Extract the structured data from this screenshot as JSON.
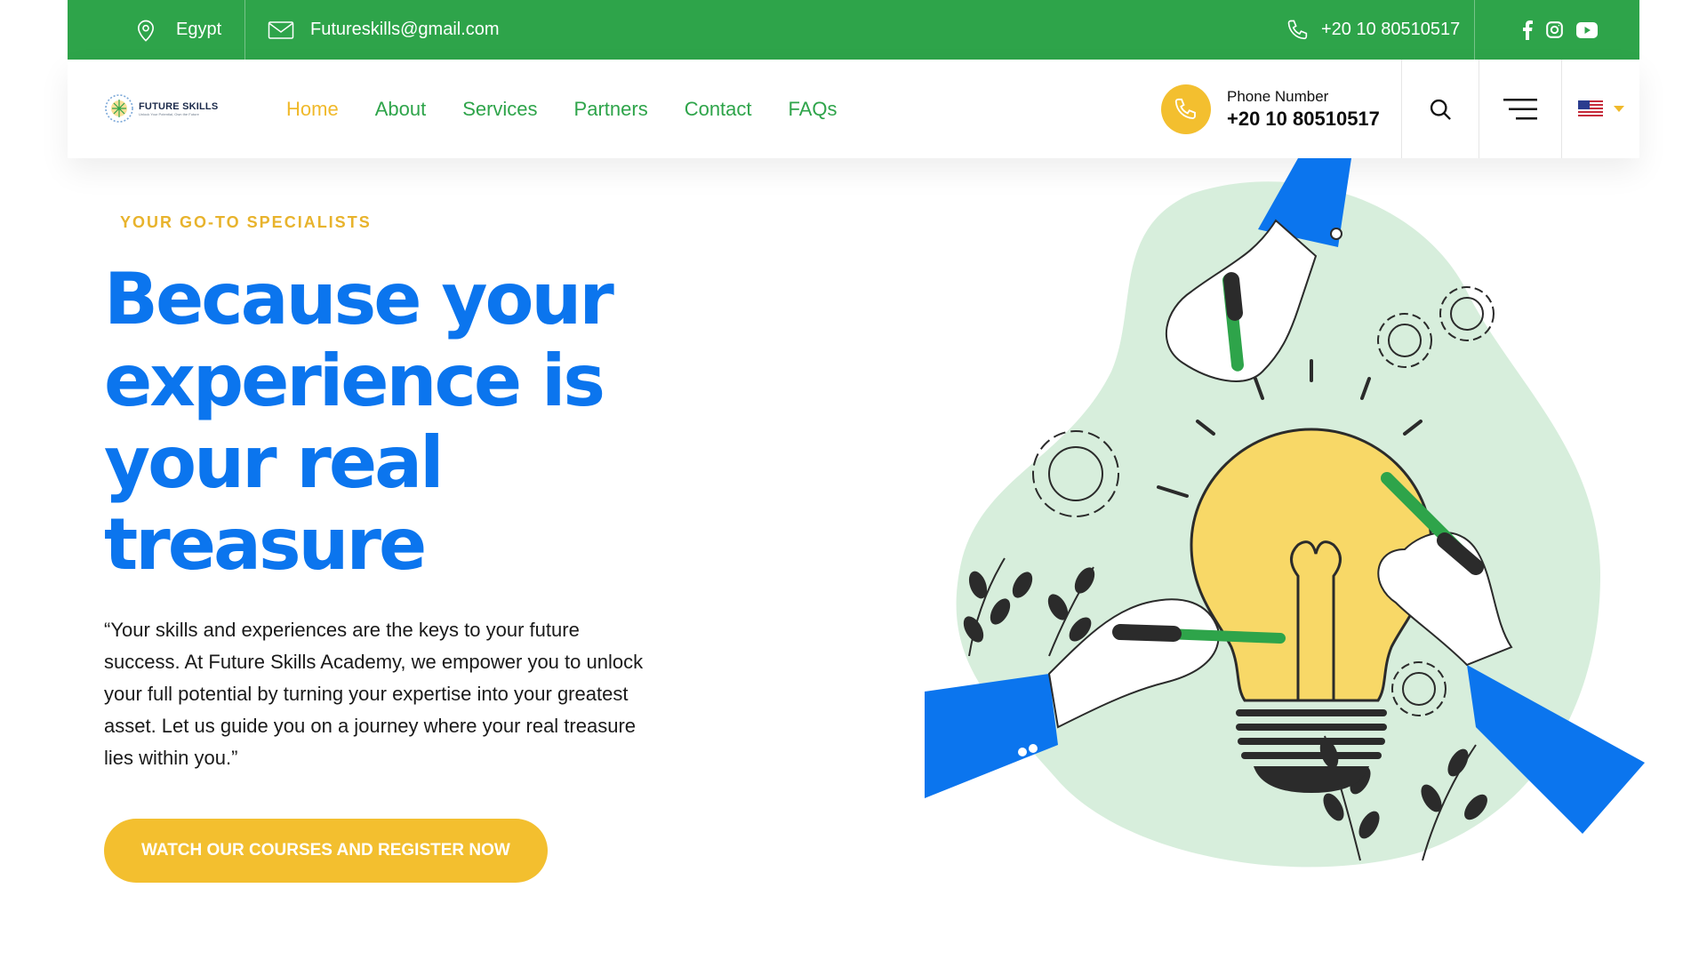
{
  "topbar": {
    "location": "Egypt",
    "email": "Futureskills@gmail.com",
    "phone": "+20 10 80510517",
    "social": [
      "facebook-icon",
      "instagram-icon",
      "youtube-icon"
    ]
  },
  "nav": {
    "logo": {
      "brand": "FUTURE SKILLS",
      "tagline": "Unlock Your Potential, Own the Future"
    },
    "items": [
      {
        "label": "Home",
        "active": true
      },
      {
        "label": "About"
      },
      {
        "label": "Services"
      },
      {
        "label": "Partners"
      },
      {
        "label": "Contact"
      },
      {
        "label": "FAQs"
      }
    ],
    "phone_label": "Phone Number",
    "phone_number": "+20 10 80510517"
  },
  "hero": {
    "eyebrow": "YOUR GO-TO SPECIALISTS",
    "headline": [
      "Because your",
      "experience is",
      "your real",
      "treasure"
    ],
    "lead": "“Your skills and experiences are the keys to your future success. At Future Skills Academy, we empower you to unlock your full potential by turning your expertise into your greatest asset. Let us guide you on a journey where your real treasure lies within you.”",
    "cta": "WATCH OUR COURSES AND REGISTER NOW"
  },
  "colors": {
    "green": "#2ea44a",
    "yellow": "#f3bf2f",
    "blue": "#0b75ee",
    "mint": "#d7eedc"
  }
}
